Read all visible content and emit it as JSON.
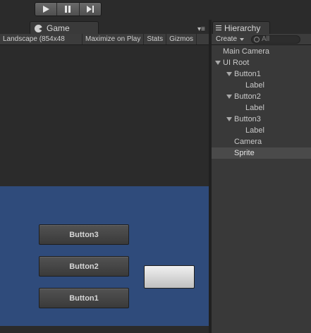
{
  "toolbar": {
    "play_icon": "play-icon",
    "pause_icon": "pause-icon",
    "step_icon": "step-icon"
  },
  "game": {
    "tab_label": "Game",
    "aspect": "Landscape (854x48",
    "maximize": "Maximize on Play",
    "stats": "Stats",
    "gizmos": "Gizmos",
    "canvas_color": "#2f4b7b",
    "buttons": {
      "b3": "Button3",
      "b2": "Button2",
      "b1": "Button1"
    }
  },
  "hierarchy": {
    "tab_label": "Hierarchy",
    "create": "Create",
    "search_placeholder": "All",
    "items": [
      {
        "label": "Main Camera"
      },
      {
        "label": "UI Root"
      },
      {
        "label": "Button1"
      },
      {
        "label": "Label"
      },
      {
        "label": "Button2"
      },
      {
        "label": "Label"
      },
      {
        "label": "Button3"
      },
      {
        "label": "Label"
      },
      {
        "label": "Camera"
      },
      {
        "label": "Sprite",
        "selected": true
      }
    ]
  }
}
